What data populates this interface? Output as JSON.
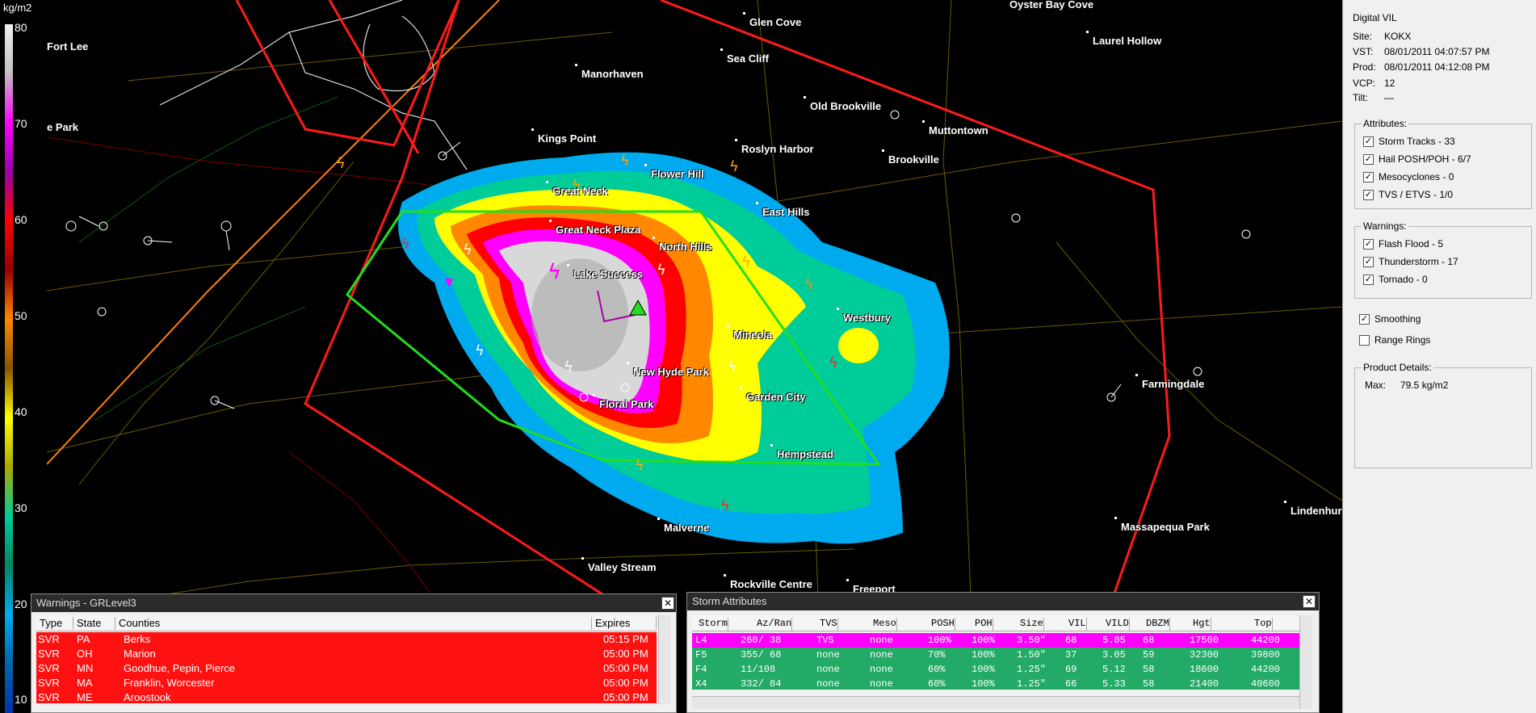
{
  "legend": {
    "unit": "kg/m2",
    "ticks": [
      "80",
      "70",
      "60",
      "50",
      "40",
      "30",
      "20",
      "10"
    ],
    "colors": [
      "#f0f0f0",
      "#c0c0c0",
      "#ff00ff",
      "#9900aa",
      "#ff0000",
      "#990000",
      "#ff8800",
      "#885500",
      "#ffff00",
      "#aaaa00",
      "#00cc99",
      "#008866",
      "#00aaee",
      "#0066aa",
      "#0033aa"
    ]
  },
  "places": [
    {
      "name": "Oyster Bay Cove"
    },
    {
      "name": "Fort Lee"
    },
    {
      "name": "Glen Cove"
    },
    {
      "name": "Laurel Hollow"
    },
    {
      "name": "Sea Cliff"
    },
    {
      "name": "Manorhaven"
    },
    {
      "name": "Old Brookville"
    },
    {
      "name": "Muttontown"
    },
    {
      "name": "e Park"
    },
    {
      "name": "Kings Point"
    },
    {
      "name": "Roslyn Harbor"
    },
    {
      "name": "Brookville"
    },
    {
      "name": "Flower Hill"
    },
    {
      "name": "Great Neck"
    },
    {
      "name": "East Hills"
    },
    {
      "name": "Great Neck Plaza"
    },
    {
      "name": "North Hills"
    },
    {
      "name": "Lake Success"
    },
    {
      "name": "Westbury"
    },
    {
      "name": "Mineola"
    },
    {
      "name": "New Hyde Park"
    },
    {
      "name": "Garden City"
    },
    {
      "name": "Floral Park"
    },
    {
      "name": "Farmingdale"
    },
    {
      "name": "Hempstead"
    },
    {
      "name": "Lindenhurst"
    },
    {
      "name": "Massapequa Park"
    },
    {
      "name": "Malverne"
    },
    {
      "name": "Valley Stream"
    },
    {
      "name": "Rockville Centre"
    },
    {
      "name": "Freeport"
    }
  ],
  "panel": {
    "product": "Digital VIL",
    "site_label": "Site:",
    "site": "KOKX",
    "vst_label": "VST:",
    "vst": "08/01/2011  04:07:57 PM",
    "prod_label": "Prod:",
    "prod": "08/01/2011  04:12:08 PM",
    "vcp_label": "VCP:",
    "vcp": "12",
    "tilt_label": "Tilt:",
    "tilt": "—",
    "attributes_title": "Attributes:",
    "attributes": [
      "Storm Tracks - 33",
      "Hail POSH/POH - 6/7",
      "Mesocyclones - 0",
      "TVS / ETVS - 1/0"
    ],
    "warnings_title": "Warnings:",
    "warnings": [
      "Flash Flood - 5",
      "Thunderstorm - 17",
      "Tornado - 0"
    ],
    "smoothing": "Smoothing",
    "range_rings": "Range Rings",
    "details_title": "Product Details:",
    "max_label": "Max:",
    "max_value": "79.5 kg/m2"
  },
  "warnings_window": {
    "title": "Warnings - GRLevel3",
    "columns": [
      "Type",
      "State",
      "Counties",
      "Expires"
    ],
    "rows": [
      [
        "SVR",
        "PA",
        "Berks",
        "05:15 PM"
      ],
      [
        "SVR",
        "OH",
        "Marion",
        "05:00 PM"
      ],
      [
        "SVR",
        "MN",
        "Goodhue, Pepin, Pierce",
        "05:00 PM"
      ],
      [
        "SVR",
        "MA",
        "Franklin, Worcester",
        "05:00 PM"
      ],
      [
        "SVR",
        "ME",
        "Aroostook",
        "05:00 PM"
      ]
    ]
  },
  "storm_window": {
    "title": "Storm Attributes",
    "columns": [
      "Storm",
      "Az/Ran",
      "TVS",
      "Meso",
      "POSH",
      "POH",
      "Size",
      "VIL",
      "VILD",
      "DBZM",
      "Hgt",
      "Top"
    ],
    "rows": [
      [
        "L4",
        "260/ 38",
        "TVS",
        "none",
        "100%",
        "100%",
        "3.50\"",
        "68",
        "5.05",
        "68",
        "17500",
        "44200"
      ],
      [
        "F5",
        "355/ 68",
        "none",
        "none",
        "70%",
        "100%",
        "1.50\"",
        "37",
        "3.05",
        "59",
        "32300",
        "39800"
      ],
      [
        "F4",
        "11/108",
        "none",
        "none",
        "60%",
        "100%",
        "1.25\"",
        "69",
        "5.12",
        "58",
        "18600",
        "44200"
      ],
      [
        "X4",
        "332/ 84",
        "none",
        "none",
        "60%",
        "100%",
        "1.25\"",
        "66",
        "5.33",
        "58",
        "21400",
        "40600"
      ]
    ],
    "row_colors": [
      "#ff00ff",
      "#22aa66",
      "#22aa66",
      "#22aa66"
    ]
  },
  "colors": {
    "warning_polygon": "#ff1a1a",
    "storm_polygon": "#22dd22",
    "county_line": "#6b5a00",
    "highway": "#ff8000"
  }
}
